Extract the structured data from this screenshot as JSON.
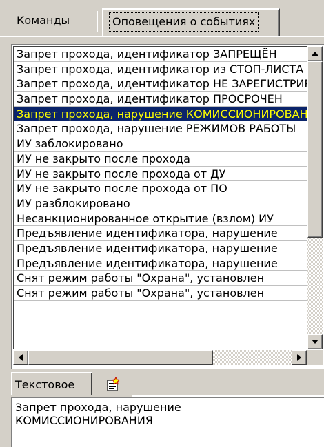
{
  "tabs": {
    "commands": "Команды",
    "notifications": "Оповещения о событиях"
  },
  "events": [
    "Запрет прохода, идентификатор ЗАПРЕЩЁН",
    "Запрет прохода, идентификатор из СТОП-ЛИСТА",
    "Запрет прохода, идентификатор НЕ ЗАРЕГИСТРИРОВАН",
    "Запрет прохода, идентификатор ПРОСРОЧЕН",
    "Запрет прохода, нарушение КОМИССИОНИРОВАНИЯ",
    "Запрет прохода, нарушение РЕЖИМОВ РАБОТЫ",
    "ИУ заблокировано",
    "ИУ не закрыто после прохода",
    "ИУ не закрыто после прохода от ДУ",
    "ИУ не закрыто после прохода от ПО",
    "ИУ разблокировано",
    "Несанкционированное открытие (взлом) ИУ",
    "Предъявление идентификатора, нарушение",
    "Предъявление идентификатора, нарушение",
    "Предъявление идентификатора, нарушение",
    "Снят режим работы \"Охрана\", установлен",
    "Снят режим работы \"Охрана\", установлен"
  ],
  "selected_index": 4,
  "bottom_tabs": {
    "text": "Текстовое",
    "icon": "new-item-icon"
  },
  "text_lines": [
    "Запрет прохода, нарушение",
    "КОМИССИОНИРОВАНИЯ"
  ],
  "colors": {
    "selection_bg": "#0a246a",
    "selection_text": "#ffff00",
    "window_bg": "#d4d0c8"
  }
}
